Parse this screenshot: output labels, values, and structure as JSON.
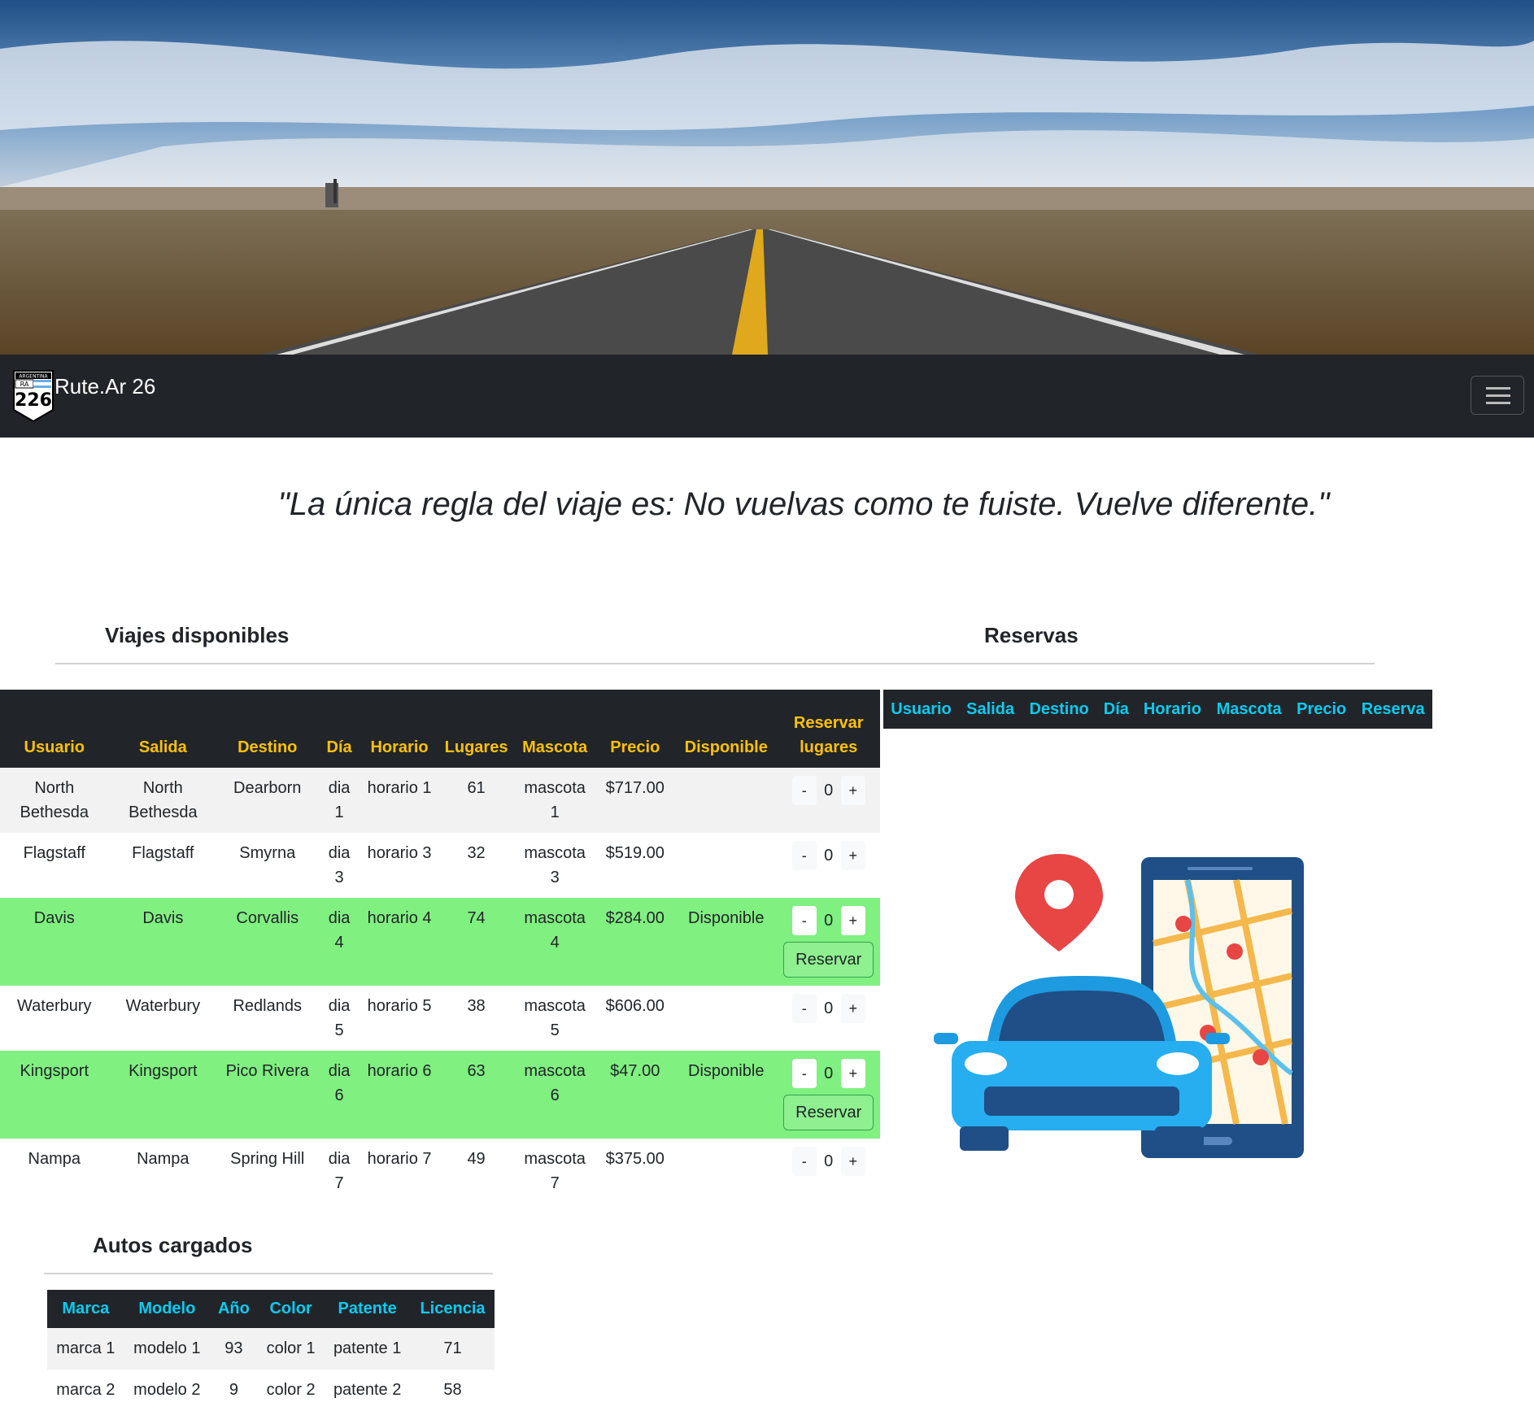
{
  "navbar": {
    "brand": "Rute.Ar 26",
    "logo_label": "ARGENTINA",
    "logo_ra": "RA",
    "logo_number": "226"
  },
  "quote": "\"La única regla del viaje es: No vuelvas como te fuiste. Vuelve diferente.\"",
  "sections": {
    "viajes": "Viajes disponibles",
    "reservas": "Reservas",
    "autos": "Autos cargados"
  },
  "viajes_table": {
    "headers": [
      "Usuario",
      "Salida",
      "Destino",
      "Día",
      "Horario",
      "Lugares",
      "Mascota",
      "Precio",
      "Disponible",
      "Reservar lugares"
    ],
    "rows": [
      {
        "usuario": "North Bethesda",
        "salida": "North Bethesda",
        "destino": "Dearborn",
        "dia": "dia 1",
        "horario": "horario 1",
        "lugares": "61",
        "mascota": "mascota 1",
        "precio": "$717.00",
        "disponible": "",
        "qty": "0"
      },
      {
        "usuario": "Flagstaff",
        "salida": "Flagstaff",
        "destino": "Smyrna",
        "dia": "dia 3",
        "horario": "horario 3",
        "lugares": "32",
        "mascota": "mascota 3",
        "precio": "$519.00",
        "disponible": "",
        "qty": "0"
      },
      {
        "usuario": "Davis",
        "salida": "Davis",
        "destino": "Corvallis",
        "dia": "dia 4",
        "horario": "horario 4",
        "lugares": "74",
        "mascota": "mascota 4",
        "precio": "$284.00",
        "disponible": "Disponible",
        "qty": "0"
      },
      {
        "usuario": "Waterbury",
        "salida": "Waterbury",
        "destino": "Redlands",
        "dia": "dia 5",
        "horario": "horario 5",
        "lugares": "38",
        "mascota": "mascota 5",
        "precio": "$606.00",
        "disponible": "",
        "qty": "0"
      },
      {
        "usuario": "Kingsport",
        "salida": "Kingsport",
        "destino": "Pico Rivera",
        "dia": "dia 6",
        "horario": "horario 6",
        "lugares": "63",
        "mascota": "mascota 6",
        "precio": "$47.00",
        "disponible": "Disponible",
        "qty": "0"
      },
      {
        "usuario": "Nampa",
        "salida": "Nampa",
        "destino": "Spring Hill",
        "dia": "dia 7",
        "horario": "horario 7",
        "lugares": "49",
        "mascota": "mascota 7",
        "precio": "$375.00",
        "disponible": "",
        "qty": "0"
      }
    ],
    "minus_label": "-",
    "plus_label": "+",
    "reservar_label": "Reservar"
  },
  "reservas_table": {
    "headers": [
      "Usuario",
      "Salida",
      "Destino",
      "Día",
      "Horario",
      "Mascota",
      "Precio",
      "Reserva"
    ]
  },
  "autos_table": {
    "headers": [
      "Marca",
      "Modelo",
      "Año",
      "Color",
      "Patente",
      "Licencia"
    ],
    "rows": [
      [
        "marca 1",
        "modelo 1",
        "93",
        "color 1",
        "patente 1",
        "71"
      ],
      [
        "marca 2",
        "modelo 2",
        "9",
        "color 2",
        "patente 2",
        "58"
      ]
    ]
  },
  "colors": {
    "navbar": "#212529",
    "header_yellow": "#ffc107",
    "header_cyan": "#0dcaf0",
    "available_row": "#80f080"
  }
}
